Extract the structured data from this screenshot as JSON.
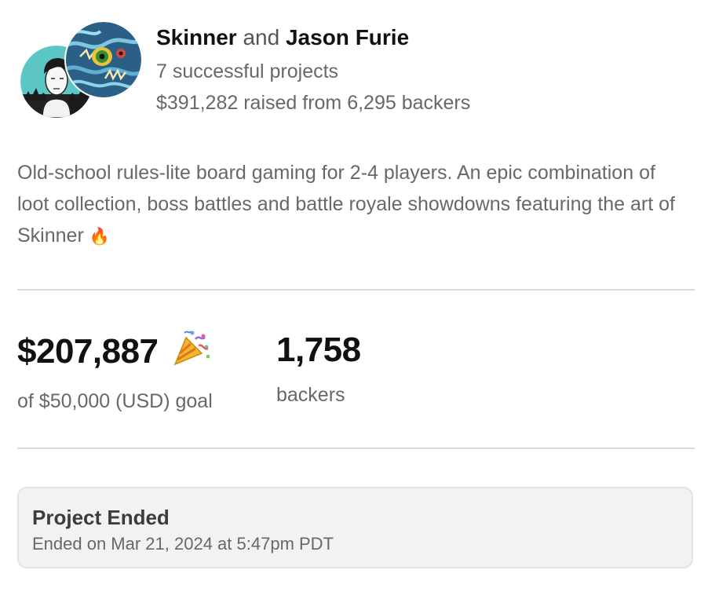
{
  "creators": {
    "first_name": "Skinner",
    "conjunction": "and",
    "second_name": "Jason Furie",
    "projects": "7 successful projects",
    "raised": "$391,282 raised from 6,295 backers",
    "avatar_one": "portrait-avatar",
    "avatar_two": "monster-art-avatar"
  },
  "blurb": {
    "text": "Old-school rules-lite board gaming for 2-4 players. An epic combination of loot collection, boss battles and battle royale showdowns featuring the art of Skinner",
    "emoji": "🔥"
  },
  "stats": {
    "pledged_amount": "$207,887",
    "pledged_icon": "party-popper-icon",
    "goal": "of $50,000 (USD) goal",
    "backers_count": "1,758",
    "backers_label": "backers"
  },
  "status": {
    "title": "Project Ended",
    "date": "Ended on Mar 21, 2024 at 5:47pm PDT"
  },
  "colors": {
    "text_primary": "#111111",
    "text_secondary": "#656969",
    "divider": "#d9d9de",
    "status_bg": "#f2f2f2",
    "avatar_teal": "#5cc6c4"
  }
}
